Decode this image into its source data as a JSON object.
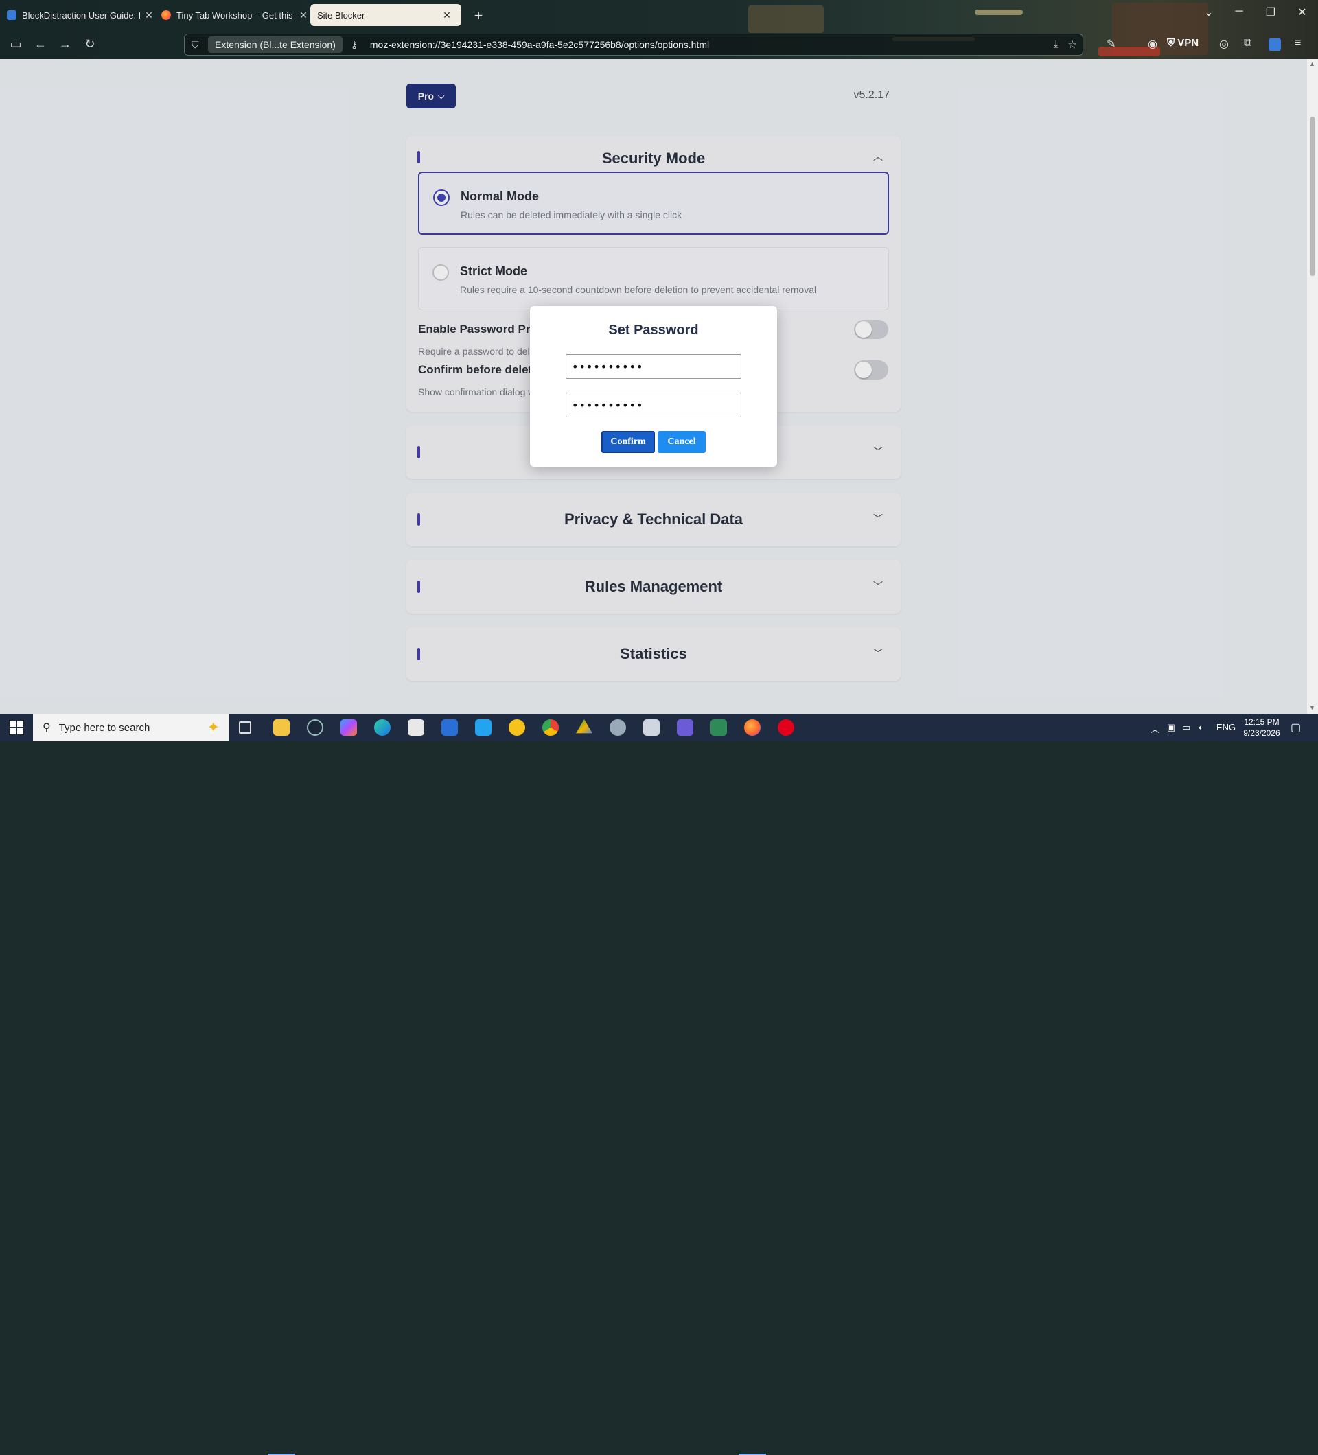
{
  "browser": {
    "tabs": [
      {
        "title": "BlockDistraction User Guide: Ru",
        "favicon": "blockdistraction-icon",
        "active": false
      },
      {
        "title": "Tiny Tab Workshop – Get this Th",
        "favicon": "firefox-icon",
        "active": false
      },
      {
        "title": "Site Blocker",
        "favicon": "",
        "active": true
      }
    ],
    "url_badge": "Extension (Bl...te Extension)",
    "url": "moz-extension://3e194231-e338-459a-a9fa-5e2c577256b8/options/options.html",
    "vpn_label": "VPN"
  },
  "page": {
    "plan_button": "Pro",
    "version": "v5.2.17",
    "security": {
      "title": "Security Mode",
      "modes": [
        {
          "name": "Normal Mode",
          "desc": "Rules can be deleted immediately with a single click",
          "selected": true
        },
        {
          "name": "Strict Mode",
          "desc": "Rules require a 10-second countdown before deletion to prevent accidental removal",
          "selected": false
        }
      ],
      "options": [
        {
          "label": "Enable Password Pro",
          "desc": "Require a password to del"
        },
        {
          "label": "Confirm before deleti",
          "desc": "Show confirmation dialog w"
        }
      ]
    },
    "sections": [
      {
        "title": ""
      },
      {
        "title": "Privacy & Technical Data"
      },
      {
        "title": "Rules Management"
      },
      {
        "title": "Statistics"
      }
    ]
  },
  "modal": {
    "title": "Set Password",
    "password1": "••••••••••",
    "password2": "••••••••••",
    "confirm_label": "Confirm",
    "cancel_label": "Cancel"
  },
  "taskbar": {
    "search_placeholder": "Type here to search",
    "language": "ENG",
    "time": "12:15 PM",
    "date": "9/23/2026"
  },
  "colors": {
    "accent": "#23307a",
    "selected_border": "#3f3fa5",
    "confirm_button": "#1a5fc7",
    "cancel_button": "#1f8cf0"
  }
}
